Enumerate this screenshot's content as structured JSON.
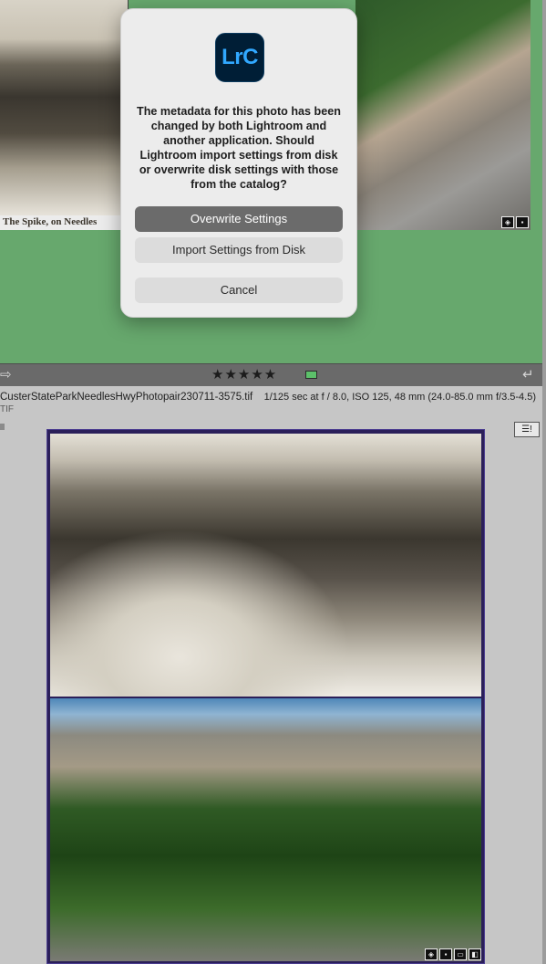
{
  "grid": {
    "left_cell_caption": "The Spike, on Needles",
    "right_cell_badges": [
      "tag-icon",
      "comment-icon"
    ]
  },
  "toolbar": {
    "back_icon": "⇨",
    "stars": "★★★★★",
    "flag_color": "#5cc06a",
    "return_icon": "↵"
  },
  "info": {
    "filename": "CusterStateParkNeedlesHwyPhotopair230711-3575.tif",
    "extension": "TIF",
    "exif": "1/125 sec at f / 8.0, ISO 125, 48 mm (24.0-85.0 mm f/3.5-4.5)",
    "list_icon": "☰!"
  },
  "main_image": {
    "badges": [
      "tag-icon",
      "comment-icon",
      "crop-icon",
      "develop-icon"
    ]
  },
  "dialog": {
    "app_icon_text": "LrC",
    "message": "The metadata for this photo has been changed by both Lightroom and another application. Should Lightroom import settings from disk or overwrite disk settings with those from the catalog?",
    "overwrite_label": "Overwrite Settings",
    "import_label": "Import Settings from Disk",
    "cancel_label": "Cancel"
  },
  "colors": {
    "grid_background": "#67a86d",
    "selection_border": "#4b3d8f",
    "lrc_icon_bg": "#001e36",
    "lrc_icon_text": "#31a8ff"
  }
}
